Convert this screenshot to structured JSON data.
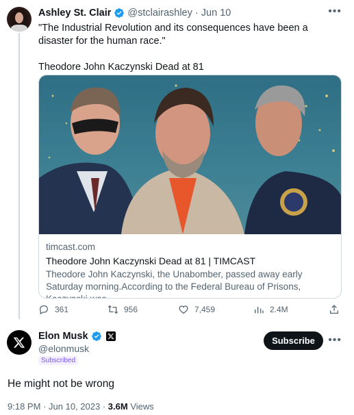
{
  "colors": {
    "accent": "#1d9bf0",
    "text": "#0f1419",
    "muted": "#536471",
    "border": "#cfd9de",
    "subscribed": "#7856ff"
  },
  "parent": {
    "author_name": "Ashley St. Clair",
    "handle": "@stclairashley",
    "separator": "·",
    "date": "Jun 10",
    "text_line1": "\"The Industrial Revolution and its consequences have been a disaster for the human race.\"",
    "text_line2": "Theodore John Kaczynski Dead at 81",
    "card": {
      "domain": "timcast.com",
      "title": "Theodore John Kaczynski Dead at 81 | TIMCAST",
      "description": "Theodore John Kaczynski, the Unabomber, passed away early Saturday morning.According to the Federal Bureau of Prisons, Kaczynski was ..."
    },
    "actions": {
      "replies": "361",
      "reposts": "956",
      "likes": "7,459",
      "views": "2.4M"
    },
    "icons": {
      "reply": "reply-icon",
      "repost": "repost-icon",
      "like": "heart-icon",
      "views": "views-icon",
      "share": "share-icon",
      "more": "more-icon",
      "verified": "verified-badge-icon"
    }
  },
  "main": {
    "author_name": "Elon Musk",
    "handle": "@elonmusk",
    "subscribed_badge": "Subscribed",
    "subscribe_label": "Subscribe",
    "text": "He might not be wrong",
    "time": "9:18 PM",
    "date": "Jun 10, 2023",
    "separator": "·",
    "views_count": "3.6M",
    "views_label": "Views",
    "icons": {
      "avatar": "x-logo-icon",
      "affiliation": "x-affiliation-icon",
      "verified": "verified-badge-icon",
      "more": "more-icon"
    }
  }
}
